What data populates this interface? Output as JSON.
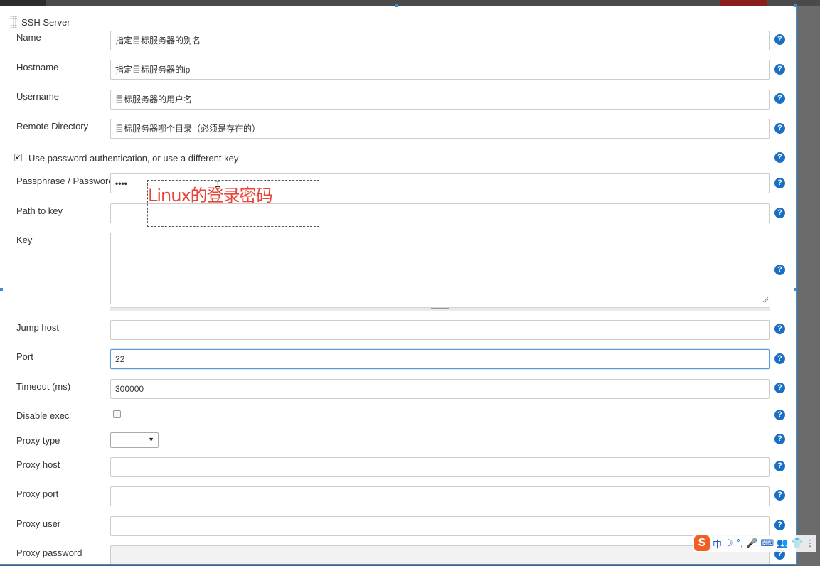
{
  "section": {
    "title": "SSH Server"
  },
  "fields": {
    "name": {
      "label": "Name",
      "value": "指定目标服务器的别名"
    },
    "hostname": {
      "label": "Hostname",
      "value": "指定目标服务器的ip"
    },
    "username": {
      "label": "Username",
      "value": "目标服务器的用户名"
    },
    "remote_directory": {
      "label": "Remote Directory",
      "value": "目标服务器哪个目录（必须是存在的）"
    },
    "use_password": {
      "label": "Use password authentication, or use a different key",
      "checked": true
    },
    "passphrase": {
      "label": "Passphrase / Password",
      "value": "••••"
    },
    "path_to_key": {
      "label": "Path to key",
      "value": ""
    },
    "key": {
      "label": "Key",
      "value": ""
    },
    "jump_host": {
      "label": "Jump host",
      "value": ""
    },
    "port": {
      "label": "Port",
      "value": "22"
    },
    "timeout": {
      "label": "Timeout (ms)",
      "value": "300000"
    },
    "disable_exec": {
      "label": "Disable exec",
      "checked": false
    },
    "proxy_type": {
      "label": "Proxy type",
      "selected": ""
    },
    "proxy_host": {
      "label": "Proxy host",
      "value": ""
    },
    "proxy_port": {
      "label": "Proxy port",
      "value": ""
    },
    "proxy_user": {
      "label": "Proxy user",
      "value": ""
    },
    "proxy_password": {
      "label": "Proxy password",
      "value": ""
    }
  },
  "help": {
    "glyph": "?"
  },
  "annotation": {
    "text": "Linux的登录密码",
    "color": "#e8443a"
  },
  "ime_toolbar": {
    "logo": "S",
    "items": [
      "中",
      "☽",
      "°,",
      "🎤",
      "⌨",
      "👥",
      "👕",
      "⋮"
    ]
  },
  "colors": {
    "help_icon": "#1a6fc4",
    "focus_border": "#5b9bd5",
    "selection": "#3c8dd6"
  }
}
